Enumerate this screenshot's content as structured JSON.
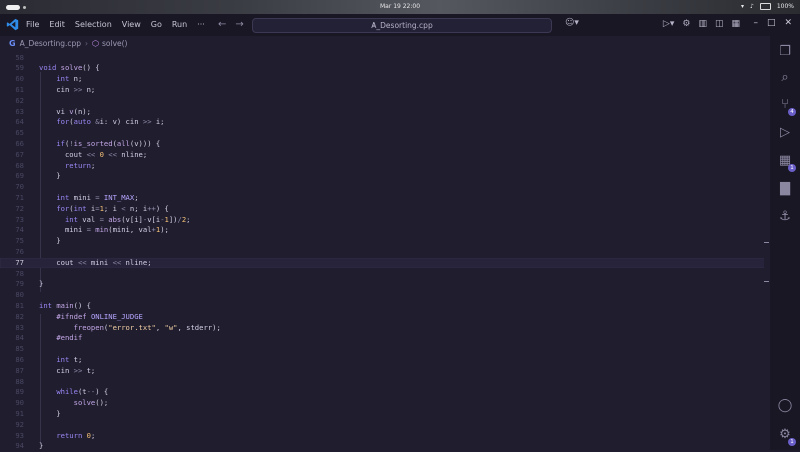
{
  "system_bar": {
    "clock": "Mar 19  22:00",
    "battery": "100%"
  },
  "window": {
    "menu": [
      "File",
      "Edit",
      "Selection",
      "View",
      "Go",
      "Run",
      "···"
    ],
    "command_center": "A_Desorting.cpp"
  },
  "breadcrumb": {
    "file": "A_Desorting.cpp",
    "symbol": "solve()"
  },
  "editor": {
    "current_line": 77,
    "lines": [
      {
        "n": 58,
        "html": ""
      },
      {
        "n": 59,
        "html": "<span class=\"ty\">void</span> <span class=\"fn\">solve</span>() {"
      },
      {
        "n": 60,
        "html": "    <span class=\"ty\">int</span> n;"
      },
      {
        "n": 61,
        "html": "    cin <span class=\"op\">&gt;&gt;</span> n;"
      },
      {
        "n": 62,
        "html": ""
      },
      {
        "n": 63,
        "html": "    vi <span class=\"fn\">v</span>(n);"
      },
      {
        "n": 64,
        "html": "    <span class=\"kw\">for</span>(<span class=\"ty\">auto</span> <span class=\"op\">&amp;</span>i: v) cin <span class=\"op\">&gt;&gt;</span> i;"
      },
      {
        "n": 65,
        "html": ""
      },
      {
        "n": 66,
        "html": "    <span class=\"kw\">if</span>(<span class=\"op\">!</span><span class=\"fn\">is_sorted</span>(<span class=\"fn\">all</span>(v))) {"
      },
      {
        "n": 67,
        "html": "      cout <span class=\"op\">&lt;&lt;</span> <span class=\"num\">0</span> <span class=\"op\">&lt;&lt;</span> nline;"
      },
      {
        "n": 68,
        "html": "      <span class=\"kw\">return</span>;"
      },
      {
        "n": 69,
        "html": "    }"
      },
      {
        "n": 70,
        "html": ""
      },
      {
        "n": 71,
        "html": "    <span class=\"ty\">int</span> mini <span class=\"op\">=</span> <span class=\"mac\">INT_MAX</span>;"
      },
      {
        "n": 72,
        "html": "    <span class=\"kw\">for</span>(<span class=\"ty\">int</span> i<span class=\"op\">=</span><span class=\"num\">1</span>; i <span class=\"op\">&lt;</span> n; i<span class=\"op\">++</span>) {"
      },
      {
        "n": 73,
        "html": "      <span class=\"ty\">int</span> val <span class=\"op\">=</span> <span class=\"fn\">abs</span>(v[i]<span class=\"op\">-</span>v[i<span class=\"op\">-</span><span class=\"num\">1</span>])<span class=\"op\">/</span><span class=\"num\">2</span>;"
      },
      {
        "n": 74,
        "html": "      mini <span class=\"op\">=</span> <span class=\"fn\">min</span>(mini, val<span class=\"op\">+</span><span class=\"num\">1</span>);"
      },
      {
        "n": 75,
        "html": "    }"
      },
      {
        "n": 76,
        "html": ""
      },
      {
        "n": 77,
        "html": "    cout <span class=\"op\">&lt;&lt;</span> mini <span class=\"op\">&lt;&lt;</span> nline;"
      },
      {
        "n": 78,
        "html": ""
      },
      {
        "n": 79,
        "html": "}"
      },
      {
        "n": 80,
        "html": ""
      },
      {
        "n": 81,
        "html": "<span class=\"ty\">int</span> <span class=\"fn\">main</span>() {"
      },
      {
        "n": 82,
        "html": "    <span class=\"pp\">#ifndef</span> <span class=\"mac\">ONLINE_JUDGE</span>"
      },
      {
        "n": 83,
        "html": "        <span class=\"fn\">freopen</span>(<span class=\"str\">\"error.txt\"</span>, <span class=\"str\">\"w\"</span>, stderr);"
      },
      {
        "n": 84,
        "html": "    <span class=\"pp\">#endif</span>"
      },
      {
        "n": 85,
        "html": ""
      },
      {
        "n": 86,
        "html": "    <span class=\"ty\">int</span> t;"
      },
      {
        "n": 87,
        "html": "    cin <span class=\"op\">&gt;&gt;</span> t;"
      },
      {
        "n": 88,
        "html": ""
      },
      {
        "n": 89,
        "html": "    <span class=\"kw\">while</span>(t<span class=\"op\">--</span>) {"
      },
      {
        "n": 90,
        "html": "        <span class=\"fn\">solve</span>();"
      },
      {
        "n": 91,
        "html": "    }"
      },
      {
        "n": 92,
        "html": ""
      },
      {
        "n": 93,
        "html": "    <span class=\"kw\">return</span> <span class=\"num\">0</span>;"
      },
      {
        "n": 94,
        "html": "}"
      }
    ]
  },
  "activity_bar": {
    "items": [
      {
        "name": "explorer-icon",
        "glyph": "❐"
      },
      {
        "name": "search-icon",
        "glyph": "⌕"
      },
      {
        "name": "source-control-icon",
        "glyph": "⑂",
        "badge": "4"
      },
      {
        "name": "run-debug-icon",
        "glyph": "▷"
      },
      {
        "name": "extensions-icon",
        "glyph": "▦",
        "badge": "1"
      },
      {
        "name": "chart-icon",
        "glyph": "▇"
      },
      {
        "name": "docker-icon",
        "glyph": "⚓"
      }
    ],
    "bottom": [
      {
        "name": "account-icon",
        "glyph": "◯"
      },
      {
        "name": "manage-gear-icon",
        "glyph": "⚙",
        "badge": "1"
      }
    ]
  }
}
